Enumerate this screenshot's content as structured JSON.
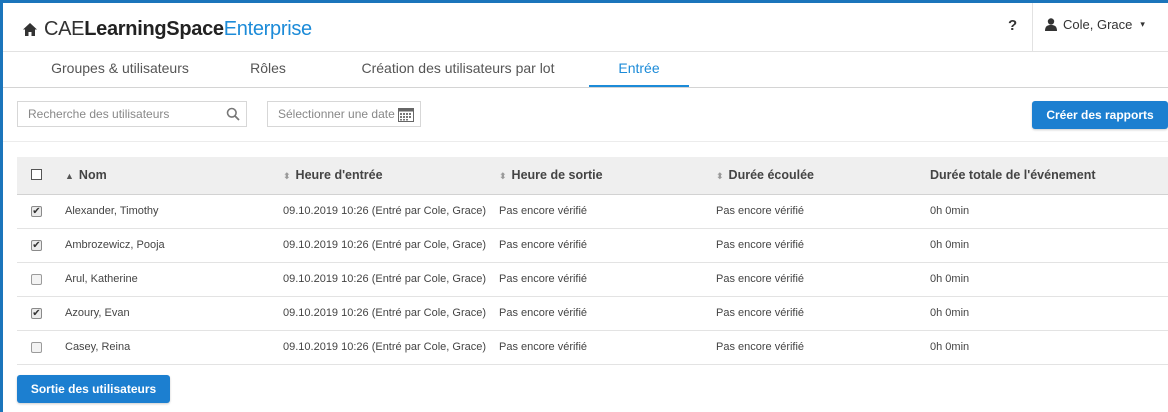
{
  "header": {
    "brand_part1": "CAE",
    "brand_part2": "LearningSpace",
    "brand_part3": "Enterprise",
    "help": "?",
    "user": "Cole, Grace",
    "user_caret": "▾"
  },
  "tabs": [
    {
      "label": "Groupes & utilisateurs"
    },
    {
      "label": "Rôles"
    },
    {
      "label": "Création des utilisateurs par lot"
    },
    {
      "label": "Entrée",
      "active": true
    }
  ],
  "toolbar": {
    "search_placeholder": "Recherche des utilisateurs",
    "date_placeholder": "Sélectionner une date",
    "report_button": "Créer des rapports"
  },
  "table": {
    "columns": [
      "Nom",
      "Heure d'entrée",
      "Heure de sortie",
      "Durée écoulée",
      "Durée totale de l'événement"
    ],
    "sort_icon_active": "▲",
    "sort_icon": "⬍",
    "rows": [
      {
        "checked": true,
        "name": "Alexander, Timothy",
        "checkin": "09.10.2019 10:26 (Entré par Cole, Grace)",
        "checkout": "Pas encore vérifié",
        "elapsed": "Pas encore vérifié",
        "total": "0h 0min"
      },
      {
        "checked": true,
        "name": "Ambrozewicz, Pooja",
        "checkin": "09.10.2019 10:26 (Entré par Cole, Grace)",
        "checkout": "Pas encore vérifié",
        "elapsed": "Pas encore vérifié",
        "total": "0h 0min"
      },
      {
        "checked": false,
        "name": "Arul, Katherine",
        "checkin": "09.10.2019 10:26 (Entré par Cole, Grace)",
        "checkout": "Pas encore vérifié",
        "elapsed": "Pas encore vérifié",
        "total": "0h 0min"
      },
      {
        "checked": true,
        "name": "Azoury, Evan",
        "checkin": "09.10.2019 10:26 (Entré par Cole, Grace)",
        "checkout": "Pas encore vérifié",
        "elapsed": "Pas encore vérifié",
        "total": "0h 0min"
      },
      {
        "checked": false,
        "name": "Casey, Reina",
        "checkin": "09.10.2019 10:26 (Entré par Cole, Grace)",
        "checkout": "Pas encore vérifié",
        "elapsed": "Pas encore vérifié",
        "total": "0h 0min"
      }
    ]
  },
  "footer": {
    "checkout_button": "Sortie des utilisateurs"
  },
  "icons": {
    "home": "home-icon",
    "search": "search-icon",
    "calendar": "calendar-icon",
    "user": "user-icon"
  },
  "colors": {
    "accent": "#1c8bd8",
    "button": "#1c7fd0",
    "frame": "#1b75bb"
  }
}
